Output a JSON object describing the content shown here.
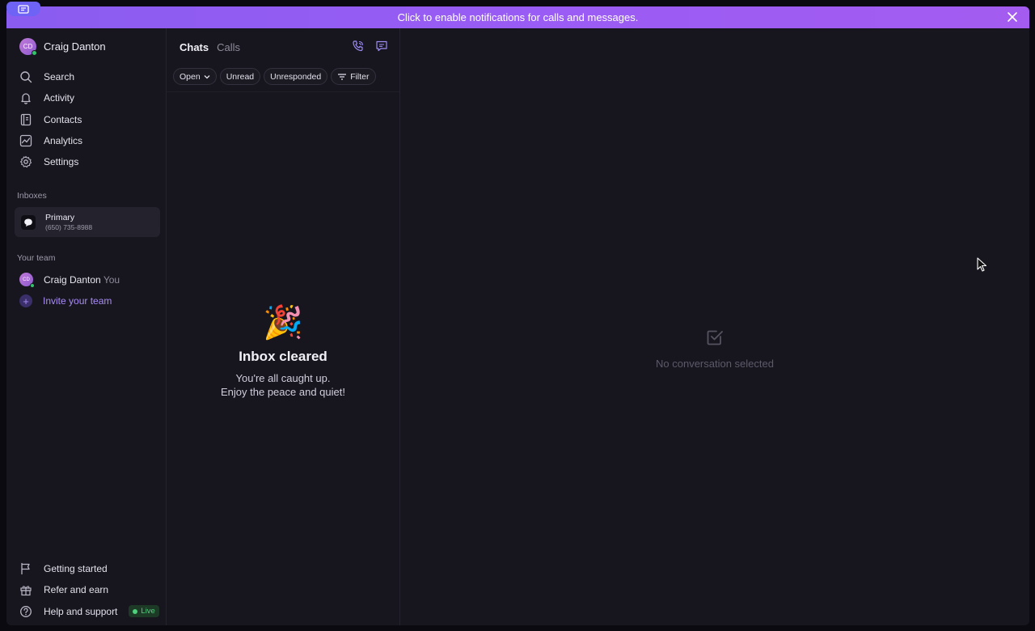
{
  "banner": {
    "text": "Click to enable notifications for calls and messages."
  },
  "profile": {
    "initials": "CD",
    "name": "Craig Danton"
  },
  "nav": [
    {
      "label": "Search",
      "icon": "search-icon"
    },
    {
      "label": "Activity",
      "icon": "bell-icon"
    },
    {
      "label": "Contacts",
      "icon": "contacts-icon"
    },
    {
      "label": "Analytics",
      "icon": "analytics-icon"
    },
    {
      "label": "Settings",
      "icon": "gear-icon"
    }
  ],
  "inboxes": {
    "label": "Inboxes",
    "items": [
      {
        "title": "Primary",
        "phone": "(650) 735-8988"
      }
    ]
  },
  "team": {
    "label": "Your team",
    "member": {
      "initials": "CD",
      "name": "Craig Danton",
      "tag": "You"
    },
    "invite": "Invite your team"
  },
  "bottom_nav": [
    {
      "label": "Getting started",
      "icon": "flag-icon"
    },
    {
      "label": "Refer and earn",
      "icon": "gift-icon"
    },
    {
      "label": "Help and support",
      "icon": "help-icon",
      "badge": "Live"
    }
  ],
  "chats": {
    "tabs": [
      "Chats",
      "Calls"
    ],
    "filters": {
      "open": "Open",
      "unread": "Unread",
      "unresponded": "Unresponded",
      "filter": "Filter"
    },
    "empty": {
      "emoji": "🎉",
      "title": "Inbox cleared",
      "line1": "You're all caught up.",
      "line2": "Enjoy the peace and quiet!"
    }
  },
  "main": {
    "empty_text": "No conversation selected"
  },
  "colors": {
    "accent": "#9a5cf4",
    "invite": "#a88cf5",
    "live": "#4fd07c",
    "background": "#17161f"
  }
}
